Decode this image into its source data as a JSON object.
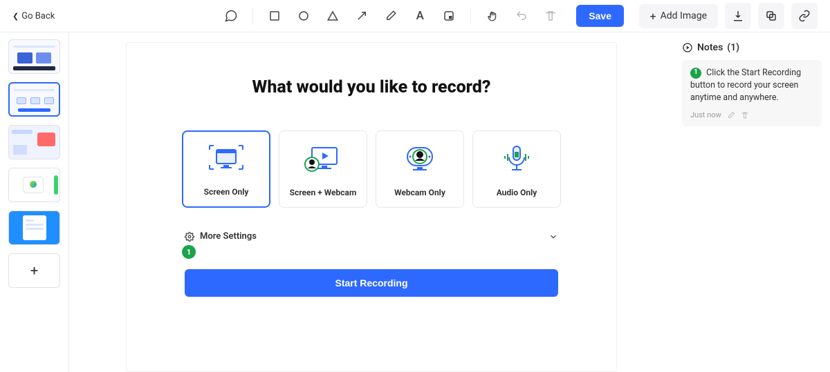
{
  "header": {
    "go_back": "Go Back",
    "save": "Save",
    "add_image": "Add Image"
  },
  "thumbnails": {
    "count": 5
  },
  "canvas": {
    "headline": "What would you like to record?",
    "cards": [
      {
        "label": "Screen Only",
        "active": true
      },
      {
        "label": "Screen + Webcam",
        "active": false
      },
      {
        "label": "Webcam Only",
        "active": false
      },
      {
        "label": "Audio Only",
        "active": false
      }
    ],
    "more_settings": "More Settings",
    "badge": "1",
    "start_button": "Start Recording"
  },
  "notes": {
    "title": "Notes",
    "count_display": "(1)",
    "items": [
      {
        "num": "1",
        "text": "Click the Start Recording button to record your screen anytime and anywhere.",
        "time": "Just now"
      }
    ]
  },
  "colors": {
    "primary": "#2e69ff",
    "accent_green": "#1aa34a"
  }
}
